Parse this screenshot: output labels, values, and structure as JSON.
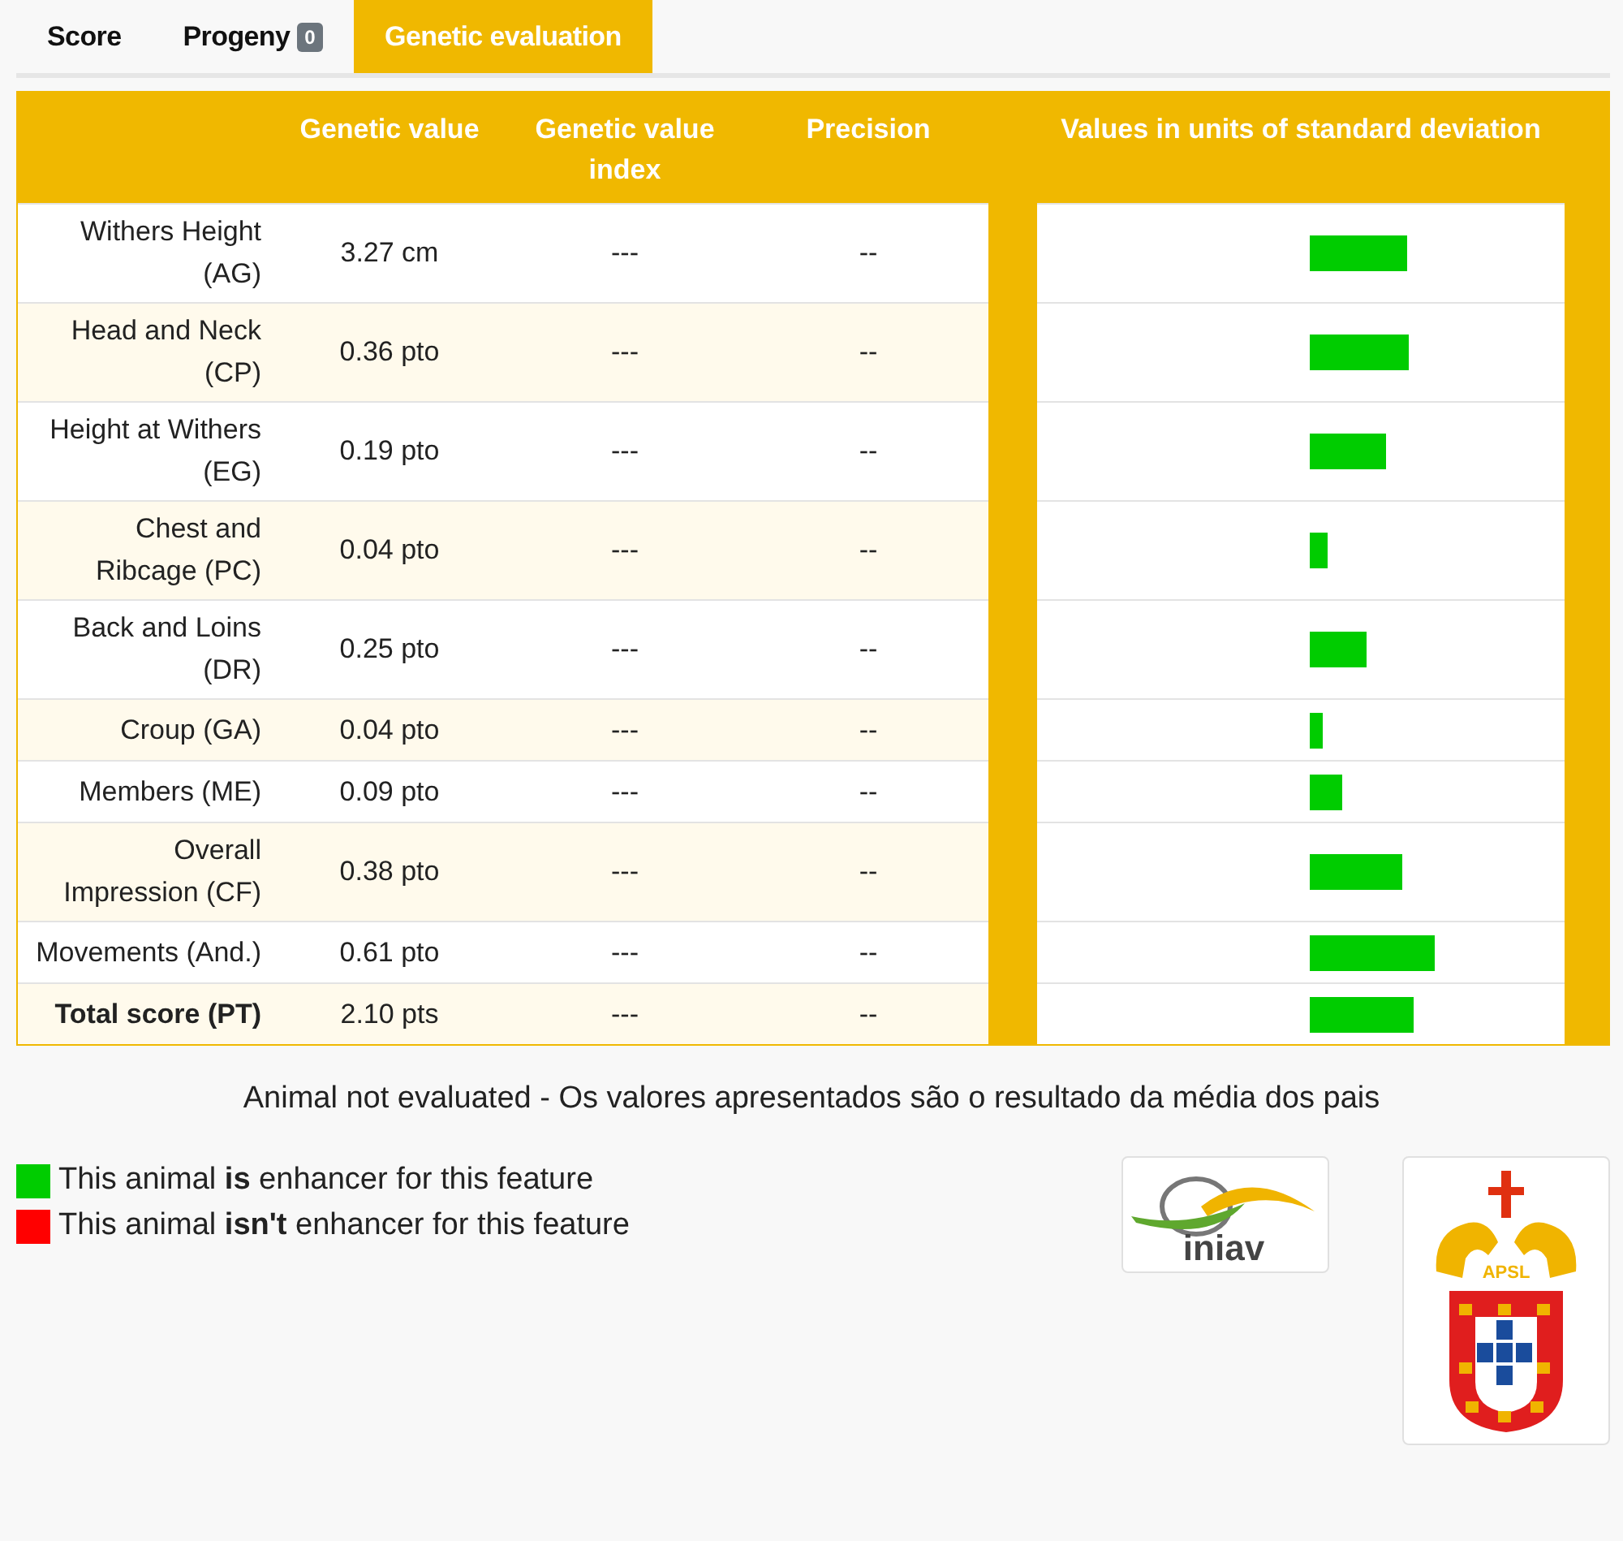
{
  "tabs": [
    {
      "label": "Score",
      "selected": false
    },
    {
      "label": "Progeny",
      "badge": "0",
      "selected": false
    },
    {
      "label": "Genetic evaluation",
      "selected": true
    }
  ],
  "table": {
    "columns": [
      "",
      "Genetic value",
      "Genetic value index",
      "Precision",
      "Values in units of standard deviation"
    ],
    "rows": [
      {
        "trait": "Withers Height (AG)",
        "value": "3.27 cm",
        "index": "---",
        "precision": "--",
        "level": 0.38,
        "enhancer": true
      },
      {
        "trait": "Head and Neck (CP)",
        "value": "0.36 pto",
        "index": "---",
        "precision": "--",
        "level": 0.39,
        "enhancer": true
      },
      {
        "trait": "Height at Withers (EG)",
        "value": "0.19 pto",
        "index": "---",
        "precision": "--",
        "level": 0.3,
        "enhancer": true
      },
      {
        "trait": "Chest and Ribcage (PC)",
        "value": "0.04 pto",
        "index": "---",
        "precision": "--",
        "level": 0.07,
        "enhancer": true
      },
      {
        "trait": "Back and Loins (DR)",
        "value": "0.25 pto",
        "index": "---",
        "precision": "--",
        "level": 0.22,
        "enhancer": true
      },
      {
        "trait": "Croup (GA)",
        "value": "0.04 pto",
        "index": "---",
        "precision": "--",
        "level": 0.05,
        "enhancer": true
      },
      {
        "trait": "Members (ME)",
        "value": "0.09 pto",
        "index": "---",
        "precision": "--",
        "level": 0.13,
        "enhancer": true
      },
      {
        "trait": "Overall Impression (CF)",
        "value": "0.38 pto",
        "index": "---",
        "precision": "--",
        "level": 0.36,
        "enhancer": true
      },
      {
        "trait": "Movements (And.)",
        "value": "0.61 pto",
        "index": "---",
        "precision": "--",
        "level": 0.49,
        "enhancer": true
      },
      {
        "trait": "Total score (PT)",
        "value": "2.10 pts",
        "index": "---",
        "precision": "--",
        "level": 0.41,
        "enhancer": true,
        "kind": "total"
      }
    ]
  },
  "note": "Animal not evaluated - Os valores apresentados são o resultado da média dos pais",
  "legend": [
    {
      "text": "This animal **is** enhancer for this feature",
      "color": "#00cc00"
    },
    {
      "text": "This animal **isn't** enhancer for this feature",
      "color": "#ff0000"
    }
  ],
  "logos": [
    {
      "kind": "iniav",
      "text": "iniav"
    },
    {
      "kind": "apsl",
      "text": "APSL"
    }
  ]
}
